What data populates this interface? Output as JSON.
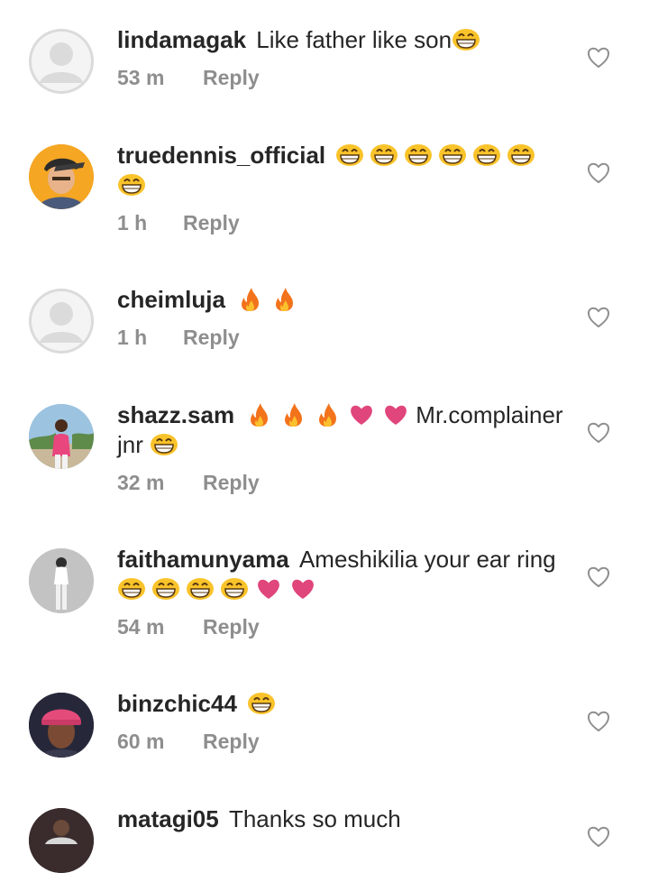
{
  "reply_label": "Reply",
  "comments": [
    {
      "user": "lindamagak",
      "text_before": "Like father like son",
      "emojis": [
        "grin"
      ],
      "text_after": "",
      "time": "53 m"
    },
    {
      "user": "truedennis_official",
      "text_before": "",
      "emojis": [
        "grin",
        "grin",
        "grin",
        "grin",
        "grin",
        "grin",
        "grin"
      ],
      "text_after": "",
      "time": "1 h"
    },
    {
      "user": "cheimluja",
      "text_before": "",
      "emojis": [
        "fire",
        "fire"
      ],
      "text_after": "",
      "time": "1 h"
    },
    {
      "user": "shazz.sam",
      "text_before": "",
      "emojis": [
        "fire",
        "fire",
        "fire",
        "heart",
        "heart"
      ],
      "text_after": "Mr.complainer jnr",
      "trailing_emojis": [
        "grin"
      ],
      "time": "32 m"
    },
    {
      "user": "faithamunyama",
      "text_before": "Ameshikilia your ear ring",
      "emojis": [
        "grin",
        "grin",
        "grin",
        "grin",
        "heart",
        "heart"
      ],
      "text_after": "",
      "time": "54 m"
    },
    {
      "user": "binzchic44",
      "text_before": "",
      "emojis": [
        "grin"
      ],
      "text_after": "",
      "time": "60 m"
    },
    {
      "user": "matagi05",
      "text_before": "Thanks so much",
      "emojis": [],
      "text_after": "",
      "time": ""
    }
  ],
  "colors": {
    "text": "#262626",
    "meta": "#8e8e8e",
    "fire": "#f2731c",
    "heart": "#e0457b",
    "emoji_face": "#f9c32a"
  }
}
